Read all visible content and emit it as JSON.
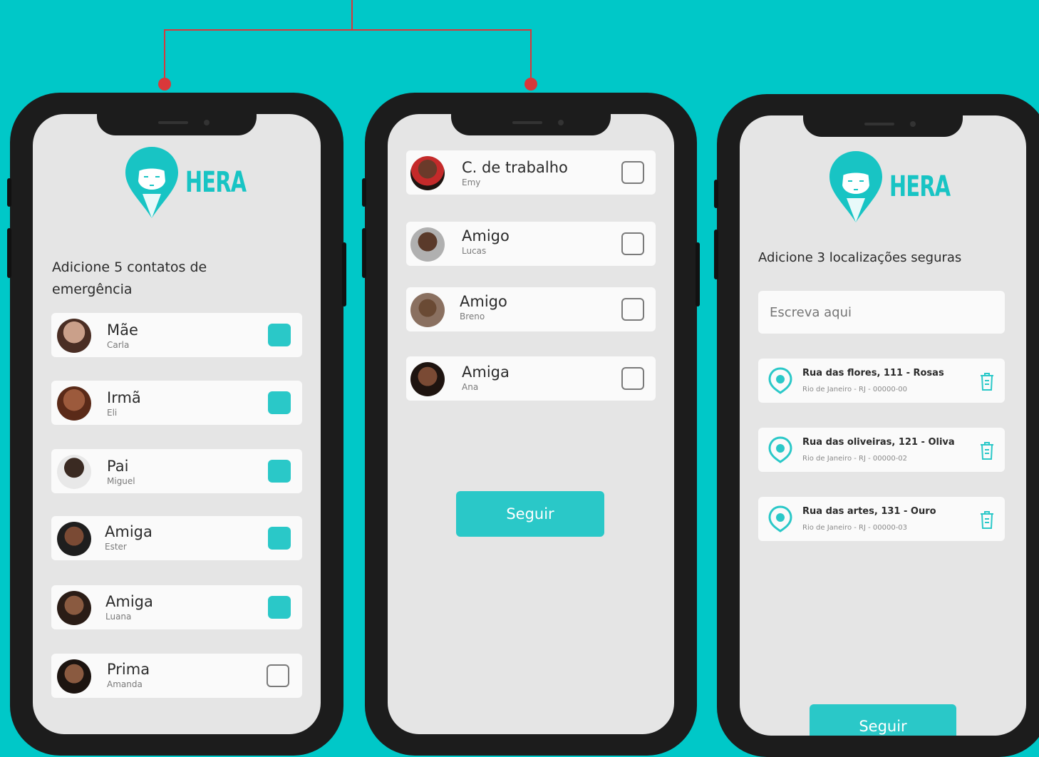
{
  "phone1": {
    "brand": "HERA",
    "heading_line1": "Adicione 5 contatos de",
    "heading_line2": "emergência",
    "contacts": [
      {
        "name": "Mãe",
        "sub": "Carla",
        "checked": true
      },
      {
        "name": "Irmã",
        "sub": "Eli",
        "checked": true
      },
      {
        "name": "Pai",
        "sub": "Miguel",
        "checked": true
      },
      {
        "name": "Amiga",
        "sub": "Ester",
        "checked": true
      },
      {
        "name": "Amiga",
        "sub": "Luana",
        "checked": true
      },
      {
        "name": "Prima",
        "sub": "Amanda",
        "checked": false
      }
    ]
  },
  "phone2": {
    "contacts": [
      {
        "name": "C. de trabalho",
        "sub": "Emy",
        "checked": false
      },
      {
        "name": "Amigo",
        "sub": "Lucas",
        "checked": false
      },
      {
        "name": "Amigo",
        "sub": "Breno",
        "checked": false
      },
      {
        "name": "Amiga",
        "sub": "Ana",
        "checked": false
      }
    ],
    "button_label": "Seguir"
  },
  "phone3": {
    "brand": "HERA",
    "heading": "Adicione 3 localizações seguras",
    "input_placeholder": "Escreva aqui",
    "locations": [
      {
        "street": "Rua das flores, 111 - Rosas",
        "city": "Rio de Janeiro - RJ - 00000-00"
      },
      {
        "street": "Rua das oliveiras, 121 - Oliva",
        "city": "Rio de Janeiro - RJ - 00000-02"
      },
      {
        "street": "Rua das artes, 131 - Ouro",
        "city": "Rio de Janeiro - RJ - 00000-03"
      }
    ],
    "button_label": "Seguir"
  },
  "colors": {
    "background": "#00c8c8",
    "accent": "#2ac8c8",
    "connector": "#d9383a",
    "phone_frame": "#1c1c1c"
  },
  "icons": {
    "location": "map-pin-icon",
    "delete": "trash-icon",
    "avatar": "avatar-photo"
  }
}
